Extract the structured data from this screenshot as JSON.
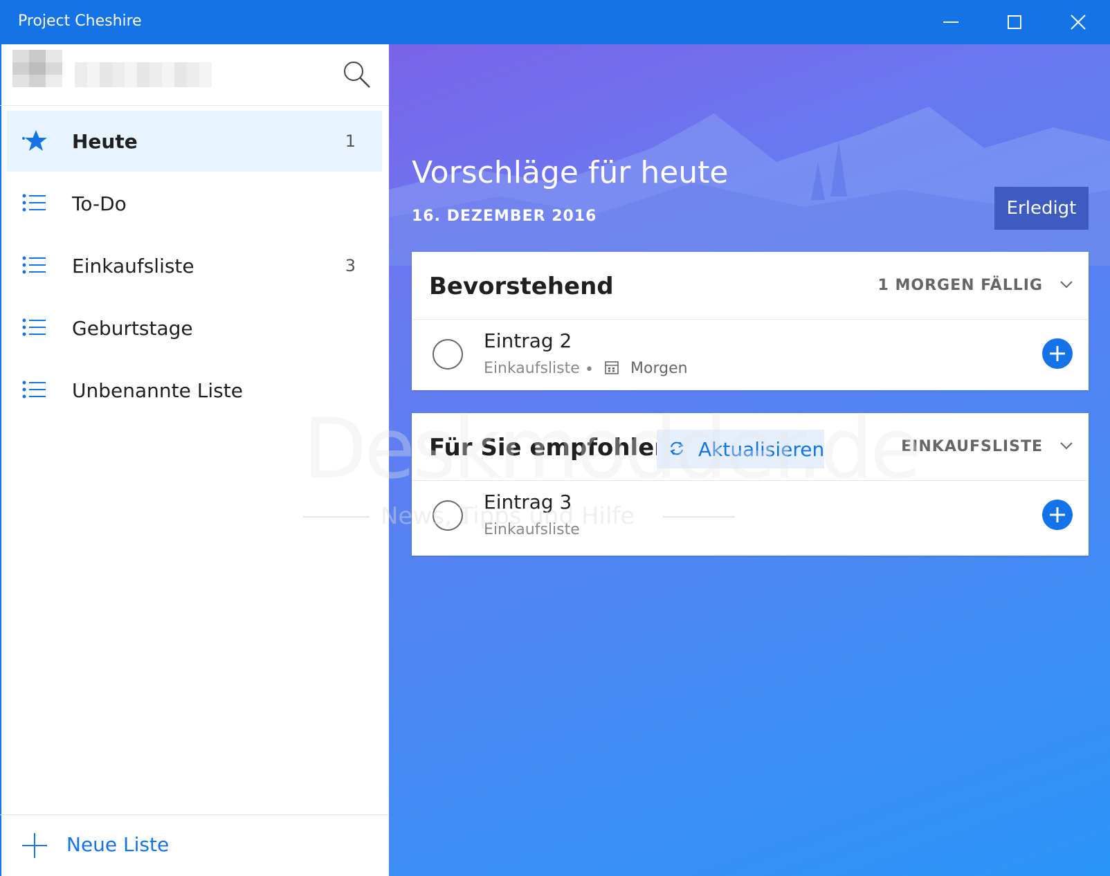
{
  "window": {
    "title": "Project Cheshire"
  },
  "sidebar": {
    "items": [
      {
        "label": "Heute",
        "count": "1",
        "icon": "star-icon"
      },
      {
        "label": "To-Do",
        "count": "",
        "icon": "list-icon"
      },
      {
        "label": "Einkaufsliste",
        "count": "3",
        "icon": "list-icon"
      },
      {
        "label": "Geburtstage",
        "count": "",
        "icon": "list-icon"
      },
      {
        "label": "Unbenannte Liste",
        "count": "",
        "icon": "list-icon"
      }
    ],
    "new_list_label": "Neue Liste"
  },
  "main": {
    "title": "Vorschläge für heute",
    "date": "16. DEZEMBER 2016",
    "done_button": "Erledigt",
    "upcoming": {
      "heading": "Bevorstehend",
      "meta": "1 MORGEN FÄLLIG",
      "task": {
        "name": "Eintrag 2",
        "list": "Einkaufsliste",
        "separator": "•",
        "due": "Morgen"
      }
    },
    "recommended": {
      "heading": "Für Sie empfohlen",
      "refresh_label": "Aktualisieren",
      "meta": "EINKAUFSLISTE",
      "task": {
        "name": "Eintrag 3",
        "list": "Einkaufsliste"
      }
    }
  },
  "watermark": {
    "brand": "Deskmodder.de",
    "tagline": "News, Tipps und Hilfe"
  },
  "colors": {
    "accent": "#1473e6",
    "active_bg": "#e6f4ff",
    "gradient_start": "#7a63e8",
    "gradient_end": "#2a95f7"
  }
}
